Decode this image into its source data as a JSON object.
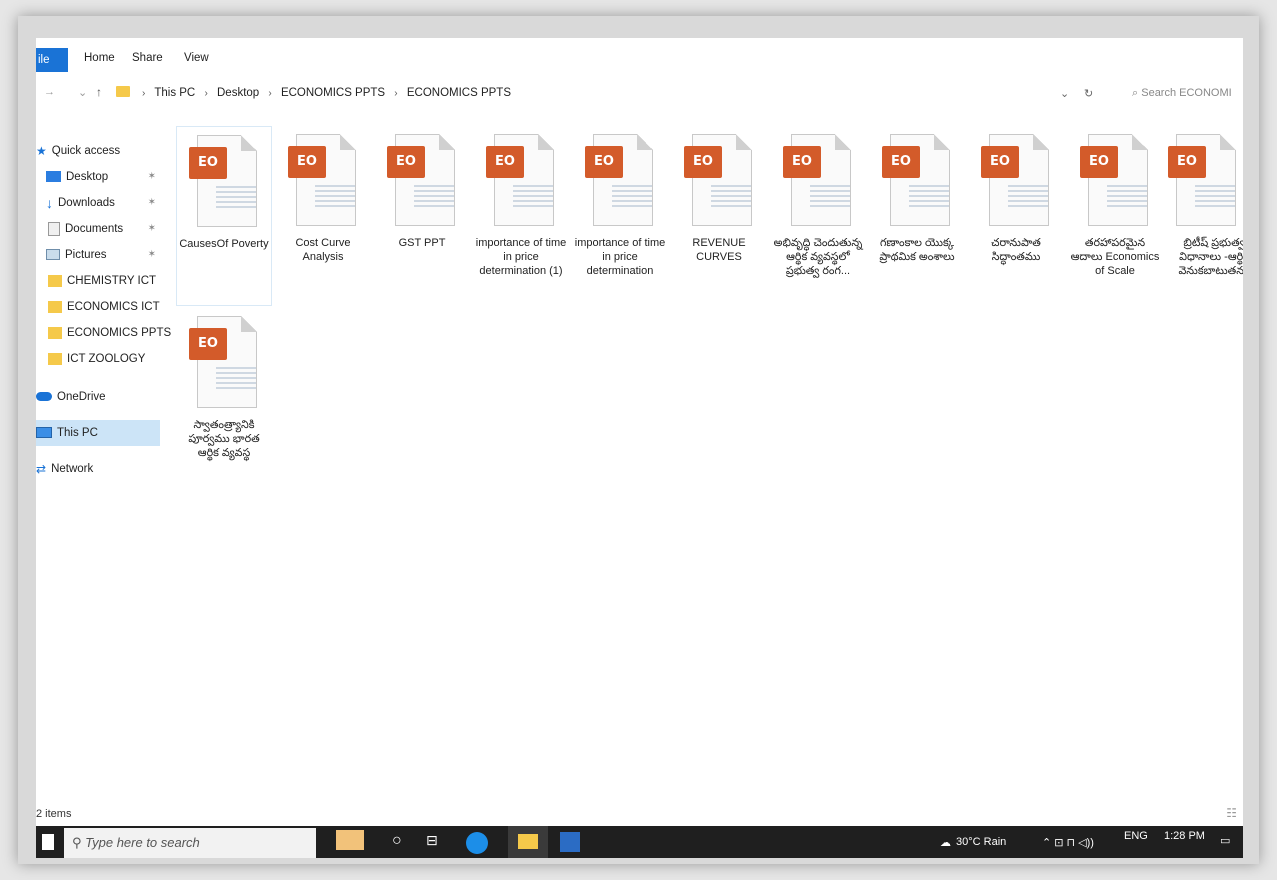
{
  "ribbon": {
    "file_label": "ile",
    "tabs": [
      "Home",
      "Share",
      "View"
    ]
  },
  "address": {
    "crumbs": [
      "This PC",
      "Desktop",
      "ECONOMICS PPTS",
      "ECONOMICS PPTS"
    ],
    "search_placeholder": "Search ECONOMI"
  },
  "sidebar": {
    "items": [
      {
        "label": "Quick access",
        "icon": "star-icon"
      },
      {
        "label": "Desktop",
        "icon": "desktop-icon",
        "pinned": true
      },
      {
        "label": "Downloads",
        "icon": "download-icon",
        "pinned": true
      },
      {
        "label": "Documents",
        "icon": "documents-icon",
        "pinned": true
      },
      {
        "label": "Pictures",
        "icon": "pictures-icon",
        "pinned": true
      },
      {
        "label": "CHEMISTRY ICT",
        "icon": "folder-icon"
      },
      {
        "label": "ECONOMICS ICT",
        "icon": "folder-icon"
      },
      {
        "label": "ECONOMICS PPTS",
        "icon": "folder-icon"
      },
      {
        "label": "ICT ZOOLOGY",
        "icon": "folder-icon"
      },
      {
        "label": "OneDrive",
        "icon": "onedrive-icon"
      },
      {
        "label": "This PC",
        "icon": "this-pc-icon",
        "selected": true
      },
      {
        "label": "Network",
        "icon": "network-icon"
      }
    ]
  },
  "files": [
    {
      "name": "CausesOf Poverty"
    },
    {
      "name": "Cost Curve Analysis"
    },
    {
      "name": "GST PPT"
    },
    {
      "name": "importance of time in price determination (1)"
    },
    {
      "name": "importance of time in price determination"
    },
    {
      "name": "REVENUE CURVES"
    },
    {
      "name": "అభివృద్ధి చెందుతున్న ఆర్థిక వ్యవస్థలో ప్రభుత్వ రంగ..."
    },
    {
      "name": "గణాంకాల యొక్క ప్రాథమిక అంశాలు"
    },
    {
      "name": "చరానుపాత సిద్ధాంతము"
    },
    {
      "name": "తరహాపరమైన ఆదాలు Economics of Scale"
    },
    {
      "name": "బ్రిటీష్ ప్రభుత్వ విధానాలు -ఆర్థిక వెనుకబాటుతనం"
    },
    {
      "name": "స్వాతంత్ర్యానికి పూర్వము భారత ఆర్థిక వ్యవస్థ"
    }
  ],
  "file_badge": "EO",
  "status": {
    "items_text": "2 items"
  },
  "taskbar": {
    "search_placeholder": "Type here to search",
    "weather": "30°C Rain",
    "language": "ENG",
    "time": "1:28 PM"
  },
  "colors": {
    "accent": "#1a73d6",
    "ppt_badge": "#d35b2a",
    "taskbar": "#1f1f1f"
  }
}
